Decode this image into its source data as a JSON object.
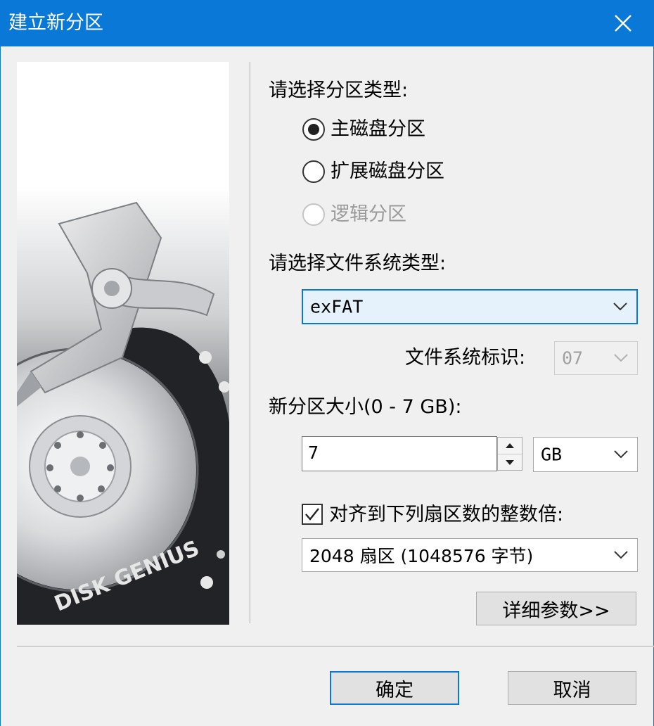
{
  "window": {
    "title": "建立新分区"
  },
  "partition_type": {
    "prompt": "请选择分区类型:",
    "options": [
      {
        "label": "主磁盘分区",
        "selected": true,
        "enabled": true
      },
      {
        "label": "扩展磁盘分区",
        "selected": false,
        "enabled": true
      },
      {
        "label": "逻辑分区",
        "selected": false,
        "enabled": false
      }
    ]
  },
  "filesystem": {
    "prompt": "请选择文件系统类型:",
    "selected": "exFAT",
    "id_label": "文件系统标识:",
    "id_value": "07"
  },
  "size": {
    "label": "新分区大小(0 - 7 GB):",
    "value": "7",
    "unit": "GB"
  },
  "align": {
    "checked": true,
    "label": "对齐到下列扇区数的整数倍:",
    "selected": "2048 扇区 (1048576 字节)"
  },
  "buttons": {
    "details": "详细参数>>",
    "ok": "确定",
    "cancel": "取消"
  },
  "side_image": {
    "brand": "DISK GENIUS"
  },
  "colors": {
    "accent": "#0a78d7",
    "background": "#f0f0f0"
  },
  "icons": [
    "close-icon",
    "chevron-down-icon",
    "spin-up-icon",
    "spin-down-icon",
    "check-icon"
  ]
}
